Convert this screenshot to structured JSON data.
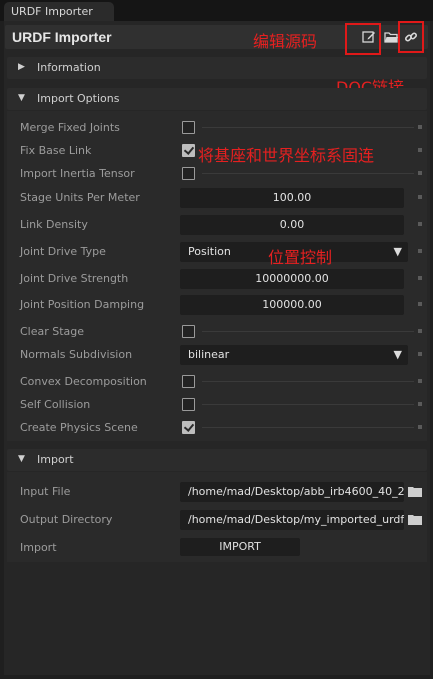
{
  "tab": {
    "title": "URDF Importer"
  },
  "header": {
    "title": "URDF Importer"
  },
  "annotations": {
    "edit_source": "编辑源码",
    "doc_link": "DOC链接",
    "fix_base": "将基座和世界坐标系固连",
    "position_control": "位置控制"
  },
  "sections": {
    "information": {
      "title": "Information"
    },
    "import_options": {
      "title": "Import Options"
    },
    "import": {
      "title": "Import"
    }
  },
  "options": {
    "merge_fixed_joints": {
      "label": "Merge Fixed Joints",
      "checked": false
    },
    "fix_base_link": {
      "label": "Fix Base Link",
      "checked": true
    },
    "import_inertia_tensor": {
      "label": "Import Inertia Tensor",
      "checked": false
    },
    "stage_units": {
      "label": "Stage Units Per Meter",
      "value": "100.00"
    },
    "link_density": {
      "label": "Link Density",
      "value": "0.00"
    },
    "joint_drive_type": {
      "label": "Joint Drive Type",
      "value": "Position"
    },
    "joint_drive_strength": {
      "label": "Joint Drive Strength",
      "value": "10000000.00"
    },
    "joint_position_damping": {
      "label": "Joint Position Damping",
      "value": "100000.00"
    },
    "clear_stage": {
      "label": "Clear Stage",
      "checked": false
    },
    "normals_subdivision": {
      "label": "Normals Subdivision",
      "value": "bilinear"
    },
    "convex_decomposition": {
      "label": "Convex Decomposition",
      "checked": false
    },
    "self_collision": {
      "label": "Self Collision",
      "checked": false
    },
    "create_physics_scene": {
      "label": "Create Physics Scene",
      "checked": true
    }
  },
  "import": {
    "input_file": {
      "label": "Input File",
      "value": "/home/mad/Desktop/abb_irb4600_40_2"
    },
    "output_directory": {
      "label": "Output Directory",
      "value": "/home/mad/Desktop/my_imported_urdf"
    },
    "import_row": {
      "label": "Import",
      "button": "IMPORT"
    }
  }
}
